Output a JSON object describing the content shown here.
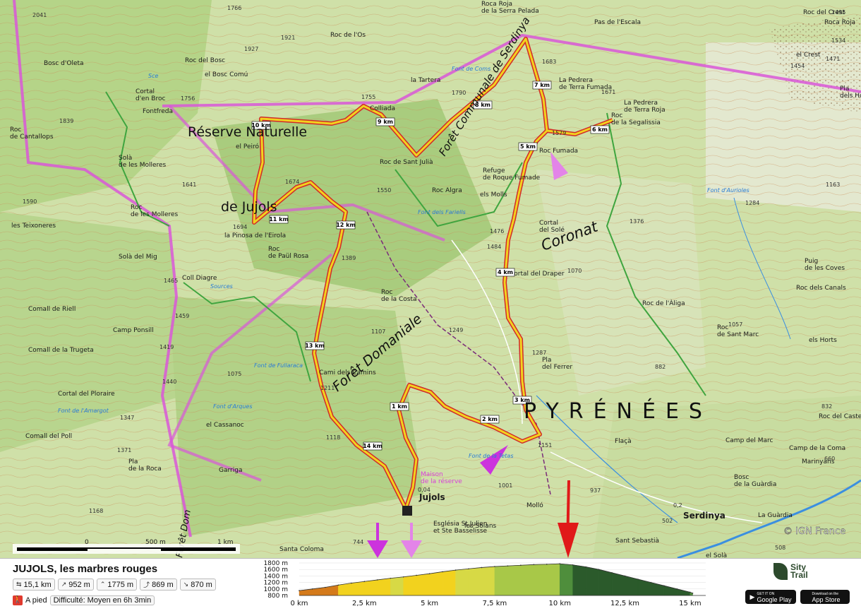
{
  "map": {
    "colors": {
      "terrain": "#cfe0a8",
      "forest": "#b5d488",
      "dark_forest": "#9cc476",
      "route": "#f2d21e",
      "route_edge": "#d12a2a",
      "boundary": "#d957d8",
      "trail": "#7a2c7a",
      "green_line": "#3fa53f",
      "river": "#3b8fe0"
    },
    "labels": [
      {
        "text": "Bosc d'Oleta"
      },
      {
        "text": "Roc del Bosc"
      },
      {
        "text": "el Bosc Comú"
      },
      {
        "text": "Roc de l'Os"
      },
      {
        "text": "la Tartera"
      },
      {
        "text": "Roca Roja de la Serra Pelada"
      },
      {
        "text": "Pas de l'Escala"
      },
      {
        "text": "Roc del Crest"
      },
      {
        "text": "Roca Roja"
      },
      {
        "text": "el Crest"
      },
      {
        "text": "Pla dels Horts"
      },
      {
        "text": "La Pedrera de Terra Fumada"
      },
      {
        "text": "La Pedrera de Terra Roja"
      },
      {
        "text": "Roc de la Segalissia"
      },
      {
        "text": "Cortal d'en Broc"
      },
      {
        "text": "Fontfreda"
      },
      {
        "text": "Roc de Cantallops"
      },
      {
        "text": "Solà de les Molleres"
      },
      {
        "text": "Colliada"
      },
      {
        "text": "Roc de Sant Julià"
      },
      {
        "text": "el Peiró"
      },
      {
        "text": "Refuge de Roque Fumade"
      },
      {
        "text": "els Molls"
      },
      {
        "text": "Roc Fumada"
      },
      {
        "text": "Roc de les Molleres"
      },
      {
        "text": "les Teixoneres"
      },
      {
        "text": "la Pinosa de l'Eirola"
      },
      {
        "text": "Roc de Paül Rosa"
      },
      {
        "text": "Cortal del Solé"
      },
      {
        "text": "Solà del Mig"
      },
      {
        "text": "Coll Diagre"
      },
      {
        "text": "Roc de la Costa"
      },
      {
        "text": "Cortal del Draper"
      },
      {
        "text": "Roc de l'Àliga"
      },
      {
        "text": "Roc dels Canals"
      },
      {
        "text": "Puig de les Coves"
      },
      {
        "text": "Camp Ponsill"
      },
      {
        "text": "Comall de Riell"
      },
      {
        "text": "Comall de la Trugeta"
      },
      {
        "text": "Cortal del Ploraire"
      },
      {
        "text": "Pla del Ferrer"
      },
      {
        "text": "Roc de Sant Marc"
      },
      {
        "text": "els Horts"
      },
      {
        "text": "Cami dels Camins"
      },
      {
        "text": "el Cassanoc"
      },
      {
        "text": "Flaçà"
      },
      {
        "text": "Camp del Marc"
      },
      {
        "text": "Camp de la Coma"
      },
      {
        "text": "Marinyans"
      },
      {
        "text": "Roc del Castell"
      },
      {
        "text": "Pla de la Roca"
      },
      {
        "text": "Garriga"
      },
      {
        "text": "Bosc de la Guàrdia"
      },
      {
        "text": "Serdinya"
      },
      {
        "text": "La Guàrdia"
      },
      {
        "text": "Jujols"
      },
      {
        "text": "Església St Julien et Ste Basselisse"
      },
      {
        "text": "les Solans"
      },
      {
        "text": "Molló"
      },
      {
        "text": "Santa Coloma"
      },
      {
        "text": "Sant Sebastià"
      },
      {
        "text": "el Solà"
      },
      {
        "text": "Maison de la réserve"
      },
      {
        "text": "Roc Algra"
      },
      {
        "text": "Comall del Poll"
      }
    ],
    "big_labels": [
      "Réserve Naturelle",
      "de Jujols"
    ],
    "forest_label": "Forêt Communale de Serdinya",
    "domaniale_label": "Forêt Domaniale",
    "coronat_label": "Coronat",
    "pyrenees_label": "PYRÉNÉES",
    "forest_dom_label": "Forêt Dom",
    "km_markers": [
      "1 km",
      "2 km",
      "3 km",
      "4 km",
      "5 km",
      "6 km",
      "7 km",
      "8 km",
      "9 km",
      "10 km",
      "11 km",
      "12 km",
      "13 km",
      "14 km"
    ],
    "elevations": [
      "2041",
      "1766",
      "1921",
      "1927",
      "1756",
      "1839",
      "1755",
      "1790",
      "1683",
      "1671",
      "1454",
      "1495",
      "1534",
      "1471",
      "1641",
      "1590",
      "1694",
      "1674",
      "1550",
      "1579",
      "1476",
      "1484",
      "1389",
      "1465",
      "1459",
      "1419",
      "1440",
      "1347",
      "1371",
      "1168",
      "1075",
      "1211",
      "1107",
      "1249",
      "1287",
      "1070",
      "1376",
      "1284",
      "1163",
      "1057",
      "832",
      "882",
      "1118",
      "1001",
      "937",
      "744",
      "502",
      "660",
      "1151",
      "508",
      "0,2",
      "0,04"
    ],
    "water_labels": [
      "Sce",
      "Font de Coms",
      "Font dels Fariells",
      "Sources",
      "Font de Fullaraca",
      "Font d'Arques",
      "Font de l'Amargot",
      "Font d'Aurioles",
      "Font de la Tetas"
    ],
    "scale": {
      "ticks": [
        "0",
        "500 m",
        "1 km"
      ]
    },
    "copyright": "© IGN France"
  },
  "summary": {
    "title": "JUJOLS, les marbres rouges",
    "stats": [
      {
        "icon": "distance-icon",
        "value": "15,1 km"
      },
      {
        "icon": "ascent-icon",
        "value": "952 m"
      },
      {
        "icon": "max-altitude-icon",
        "value": "1775 m"
      },
      {
        "icon": "elevation-gain-icon",
        "value": "869 m"
      },
      {
        "icon": "descent-icon",
        "value": "870 m"
      }
    ],
    "activity": "A pied",
    "difficulty": "Difficulté: Moyen en 6h 3min"
  },
  "chart_data": {
    "type": "area",
    "title": "",
    "xlabel": "",
    "ylabel": "",
    "x_ticks": [
      "0 km",
      "2,5 km",
      "5 km",
      "7,5 km",
      "10 km",
      "12,5 km",
      "15 km"
    ],
    "y_ticks": [
      "800 m",
      "1000 m",
      "1200 m",
      "1400 m",
      "1600 m",
      "1800 m"
    ],
    "xlim": [
      0,
      15.6
    ],
    "ylim": [
      800,
      1800
    ],
    "x": [
      0,
      0.5,
      1,
      1.5,
      2,
      2.5,
      3,
      3.5,
      4,
      4.5,
      5,
      5.5,
      6,
      6.5,
      7,
      7.5,
      8,
      8.5,
      9,
      9.5,
      10,
      10.5,
      11,
      11.5,
      12,
      12.5,
      13,
      13.5,
      14,
      14.5,
      15,
      15.1
    ],
    "y": [
      950,
      1000,
      1050,
      1120,
      1180,
      1230,
      1280,
      1330,
      1370,
      1420,
      1470,
      1530,
      1580,
      1620,
      1660,
      1690,
      1710,
      1730,
      1750,
      1760,
      1775,
      1740,
      1680,
      1600,
      1500,
      1400,
      1300,
      1200,
      1100,
      1000,
      900,
      870
    ]
  },
  "branding": {
    "name_line1": "Sity",
    "name_line2": "Trail",
    "google": "Google Play",
    "apple": "App Store",
    "google_small": "GET IT ON",
    "apple_small": "Download on the"
  }
}
